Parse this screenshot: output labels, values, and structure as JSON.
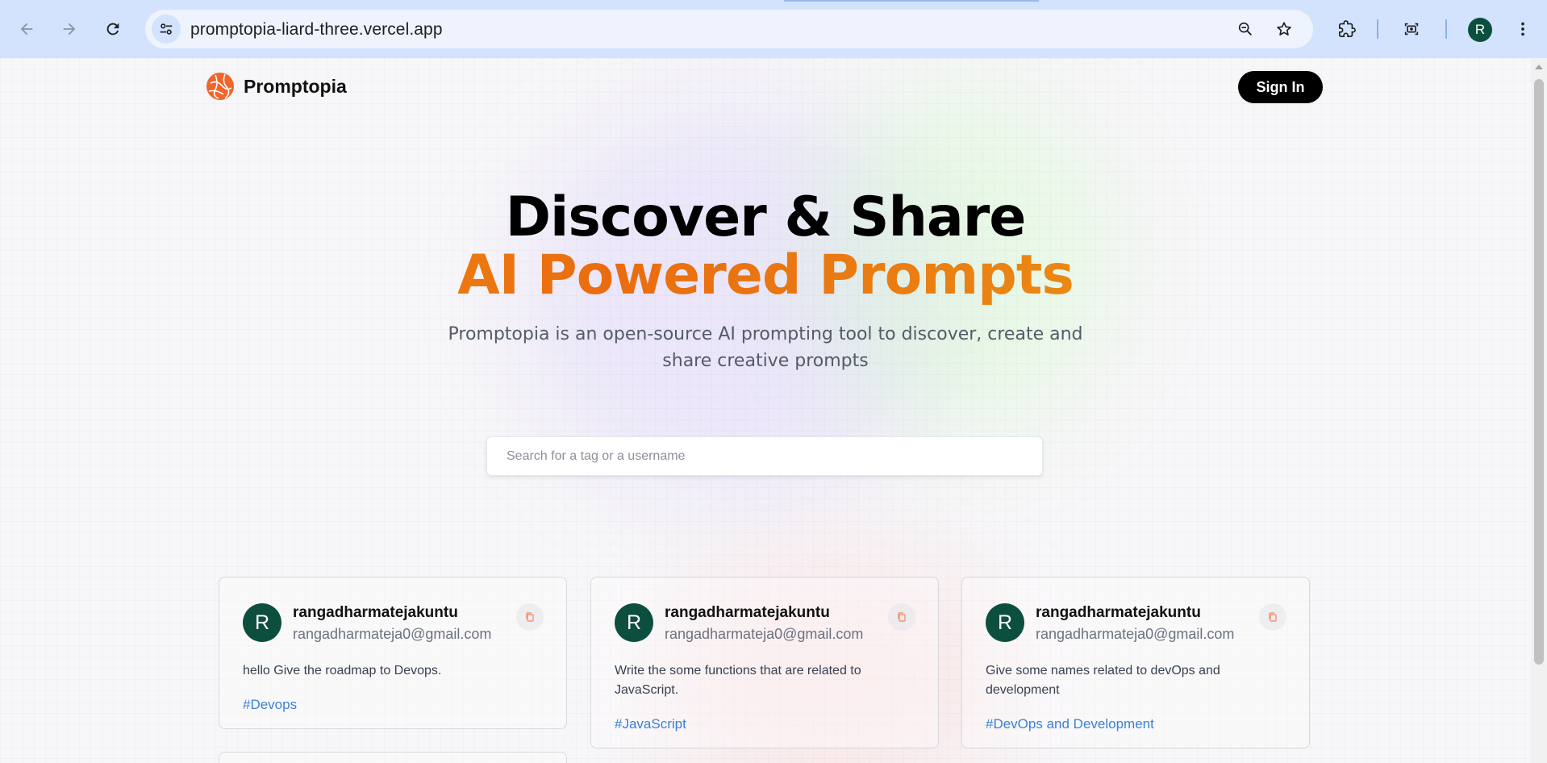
{
  "browser": {
    "url": "promptopia-liard-three.vercel.app",
    "profile_initial": "R",
    "icons": {
      "back": "arrow-left-icon",
      "forward": "arrow-right-icon",
      "reload": "reload-icon",
      "site_info": "tune-icon",
      "zoom": "zoom-out-icon",
      "bookmark": "star-icon",
      "extensions": "puzzle-icon",
      "screenshot": "camera-icon",
      "menu": "kebab-menu-icon"
    }
  },
  "nav": {
    "brand": "Promptopia",
    "signin_label": "Sign In"
  },
  "hero": {
    "title_line1": "Discover & Share",
    "title_line2": "AI Powered Prompts",
    "description": "Promptopia is an open-source AI prompting tool to discover, create and share creative prompts"
  },
  "search": {
    "placeholder": "Search for a tag or a username",
    "value": ""
  },
  "cards": [
    {
      "avatar_initial": "R",
      "username": "rangadharmatejakuntu",
      "email": "rangadharmateja0@gmail.com",
      "prompt": "hello Give the roadmap to Devops.",
      "tag": "#Devops"
    },
    {
      "avatar_initial": "R",
      "username": "rangadharmatejakuntu",
      "email": "rangadharmateja0@gmail.com",
      "prompt": "Write the some functions that are related to JavaScript.",
      "tag": "#JavaScript"
    },
    {
      "avatar_initial": "R",
      "username": "rangadharmatejakuntu",
      "email": "rangadharmateja0@gmail.com",
      "prompt": "Give some names related to devOps and development",
      "tag": "#DevOps and Development"
    }
  ],
  "colors": {
    "brand_orange": "#ea6c10",
    "avatar_green": "#0d4f3f",
    "tag_blue": "#3b7fd8",
    "chrome_blue": "#d3e3fd"
  }
}
